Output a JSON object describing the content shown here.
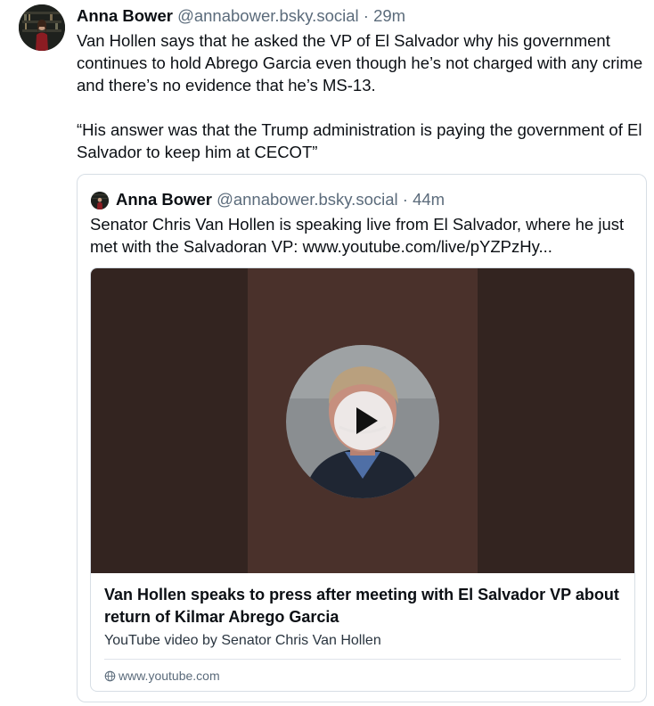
{
  "post": {
    "author_name": "Anna Bower",
    "handle": "@annabower.bsky.social",
    "separator": "·",
    "time": "29m",
    "paragraphs": [
      "Van Hollen says that he asked the VP of El Salvador why his government continues to hold Abrego Garcia even though he’s not charged with any crime and there’s no evidence that he’s MS-13.",
      "“His answer was that the Trump administration is paying the government of El Salvador to keep him at CECOT”"
    ]
  },
  "quote": {
    "author_name": "Anna Bower",
    "handle": "@annabower.bsky.social",
    "separator": "·",
    "time": "44m",
    "text": "Senator Chris Van Hollen is speaking live from El Salvador, where he just met with the Salvadoran VP: www.youtube.com/live/pYZPzHy...",
    "embed": {
      "title": "Van Hollen speaks to press after meeting with El Salvador VP about return of Kilmar Abrego Garcia",
      "description": "YouTube video by Senator Chris Van Hollen",
      "domain": "www.youtube.com",
      "icon": "globe-icon",
      "play_icon": "play-icon"
    }
  },
  "colors": {
    "text": "#0b0f14",
    "muted": "#5b6b7b",
    "border": "#d7dee5",
    "thumb_dark": "#332420",
    "thumb_mid": "#4a312b"
  }
}
